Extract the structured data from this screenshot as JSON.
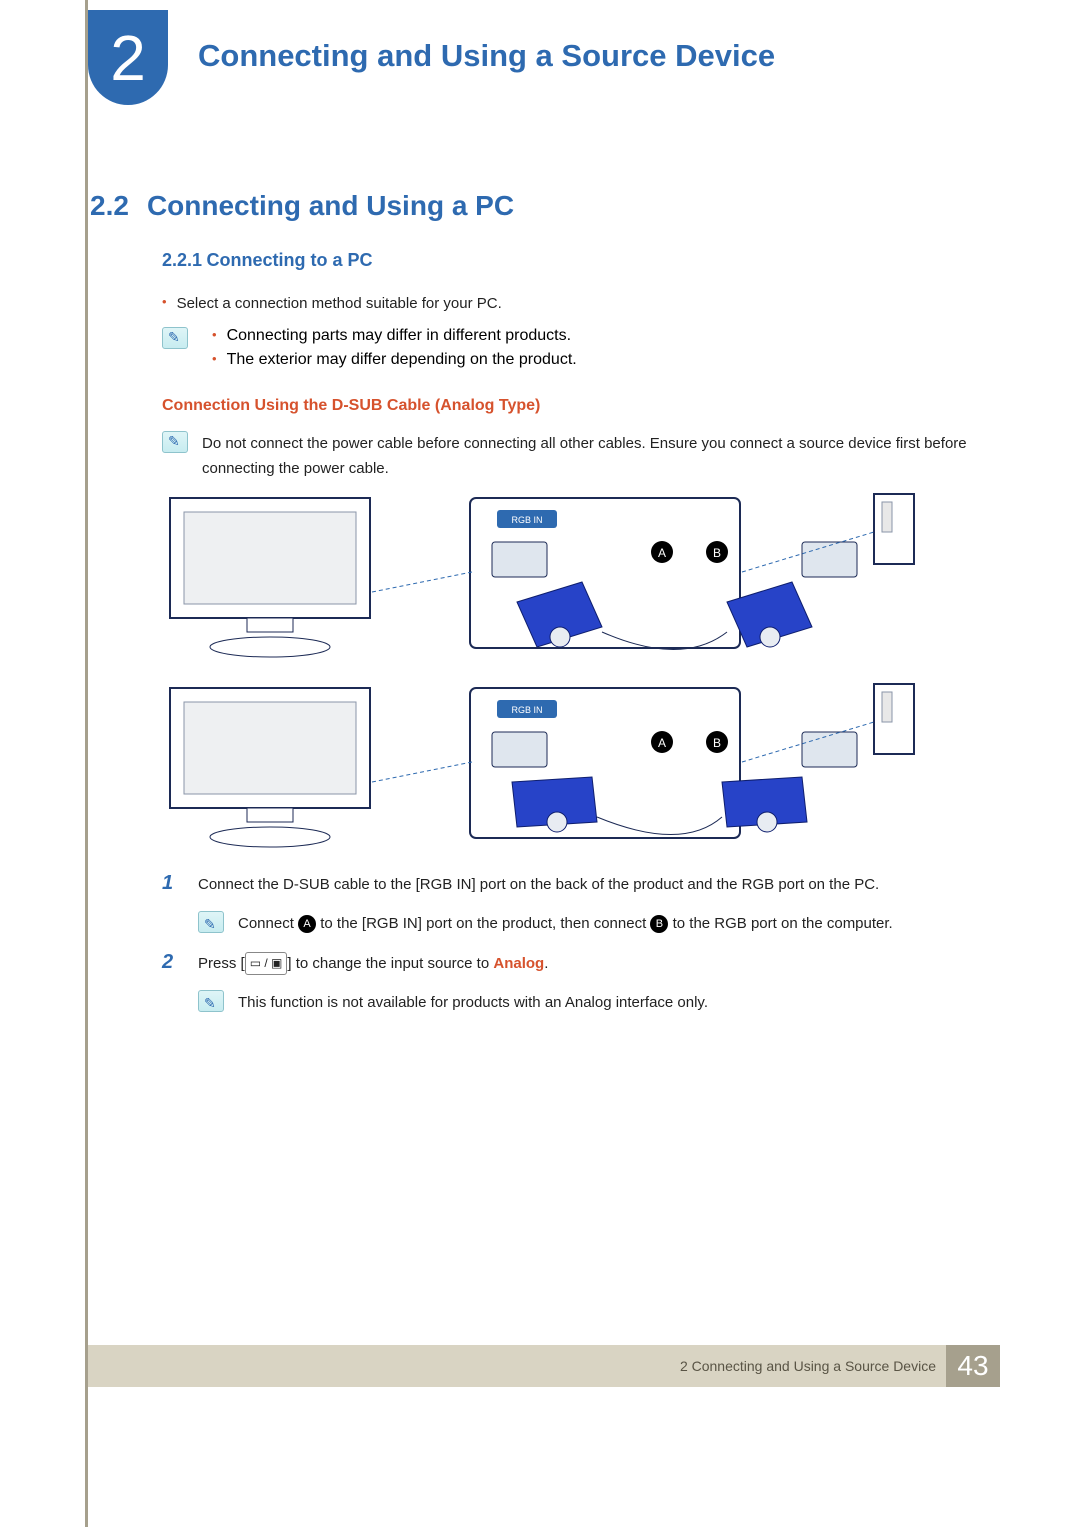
{
  "chapter": {
    "number": "2",
    "title": "Connecting and Using a Source Device"
  },
  "section": {
    "number": "2.2",
    "title": "Connecting and Using a PC"
  },
  "subsection": {
    "number": "2.2.1",
    "title": "Connecting to a PC"
  },
  "bullets": {
    "b1": "Select a connection method suitable for your PC.",
    "b2": "Connecting parts may differ in different products.",
    "b3": "The exterior may differ depending on the product."
  },
  "red_heading": "Connection Using the D-SUB Cable (Analog Type)",
  "note1": "Do not connect the power cable before connecting all other cables. Ensure you connect a source device first before connecting the power cable.",
  "diagram": {
    "port_label": "RGB IN",
    "labelA": "A",
    "labelB": "B"
  },
  "steps": {
    "s1_num": "1",
    "s1_text": "Connect the D-SUB cable to the [RGB IN] port on the back of the product and the RGB port on the PC.",
    "s1_note_pre": "Connect ",
    "s1_note_mid1": " to the [RGB IN] port on the product, then connect ",
    "s1_note_mid2": " to the RGB port on the computer.",
    "s2_num": "2",
    "s2_text_pre": "Press [",
    "s2_text_post": "] to change the input source to ",
    "s2_analog": "Analog",
    "s2_period": ".",
    "s2_note": "This function is not available for products with an Analog interface only."
  },
  "footer": {
    "label_num": "2",
    "label_text": "Connecting and Using a Source Device",
    "page": "43"
  }
}
